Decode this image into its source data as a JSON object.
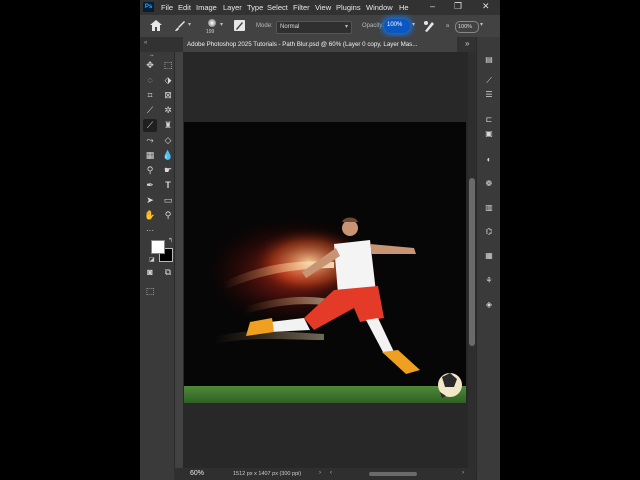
{
  "app": {
    "logo": "Ps"
  },
  "menubar": {
    "items": [
      "File",
      "Edit",
      "Image",
      "Layer",
      "Type",
      "Select",
      "Filter",
      "View",
      "Plugins",
      "Window",
      "He"
    ]
  },
  "options": {
    "brush_size": "199",
    "mode_label": "Mode:",
    "mode_value": "Normal",
    "opacity_label": "Opacity:",
    "opacity_value": "100%",
    "flow_value": "100%"
  },
  "document": {
    "tab_title": "Adobe Photoshop 2025 Tutorials - Path Blur.psd @ 60% (Layer 0 copy, Layer Mas..."
  },
  "status": {
    "zoom": "60%",
    "doc_info": "1512 px x 1407 px (300 ppi)"
  },
  "colors": {
    "opacity_highlight": "#1473e6",
    "foreground": "#ffffff",
    "background": "#000000"
  },
  "toolbox": {
    "tools": [
      "move-tool-icon",
      "marquee-tool-icon",
      "lasso-tool-icon",
      "object-select-tool-icon",
      "crop-tool-icon",
      "frame-tool-icon",
      "eyedropper-tool-icon",
      "spot-healing-tool-icon",
      "brush-tool-icon",
      "clone-stamp-tool-icon",
      "history-brush-tool-icon",
      "eraser-tool-icon",
      "gradient-tool-icon",
      "blur-tool-icon",
      "dodge-tool-icon",
      "pen-tool-icon",
      "type-tool-icon",
      "path-select-tool-icon",
      "rectangle-tool-icon",
      "hand-tool-icon",
      "zoom-tool-icon"
    ]
  }
}
